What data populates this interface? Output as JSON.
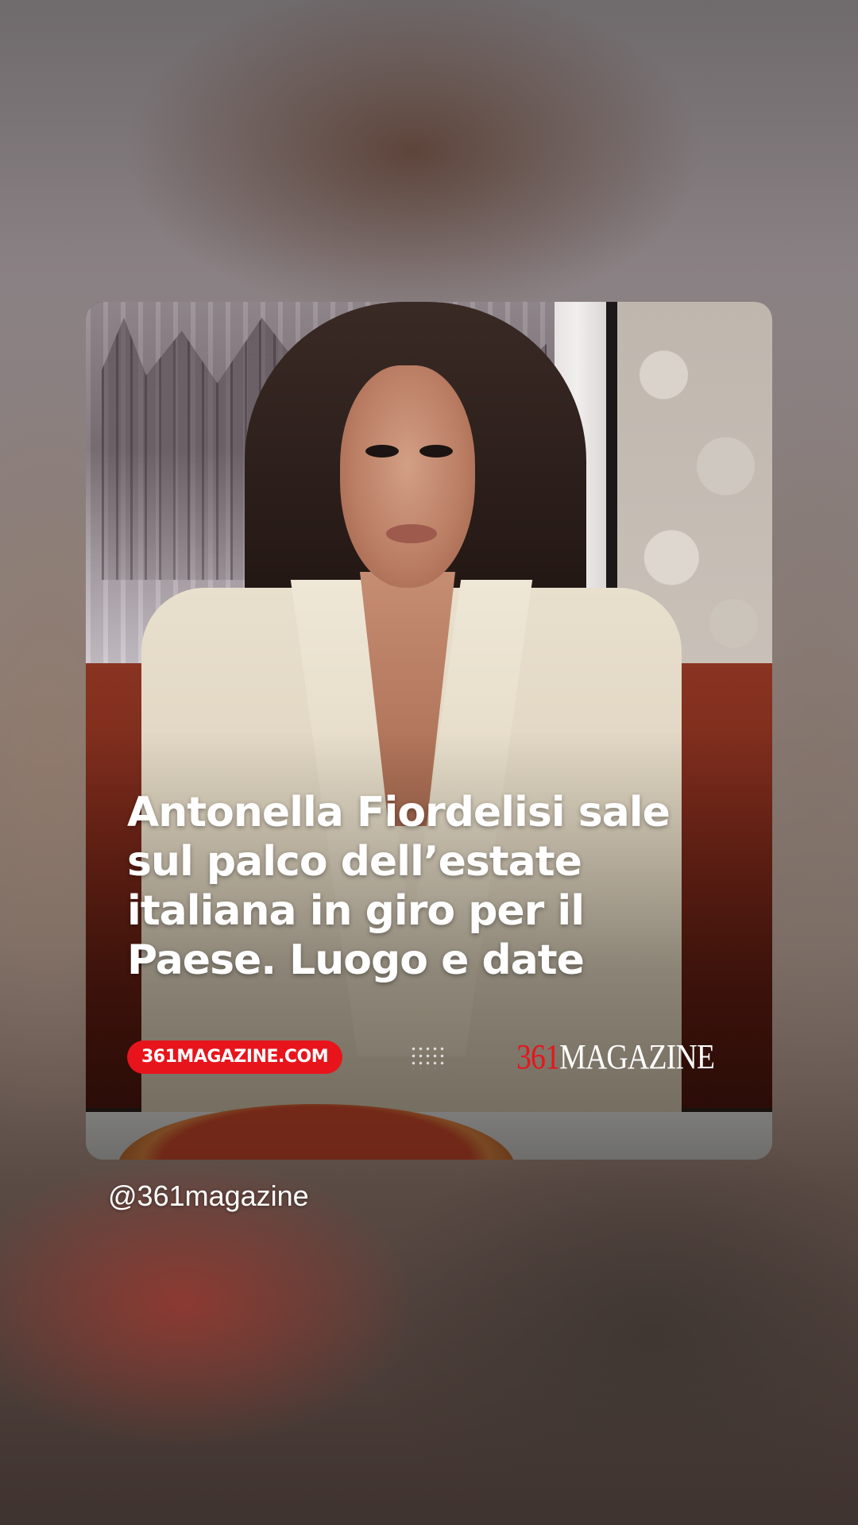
{
  "post": {
    "headline": "Antonella Fiordelisi sale sul palco dell’estate italiana in giro per il Paese. Luogo e date",
    "site_label": "361MAGAZINE.COM",
    "brand_logo_number": "361",
    "brand_logo_word": "MAGAZINE",
    "author_handle": "@361magazine"
  },
  "colors": {
    "accent_red": "#e8141c",
    "text_white": "#ffffff"
  },
  "icons": {
    "dots_pattern": "dot-grid-icon"
  }
}
